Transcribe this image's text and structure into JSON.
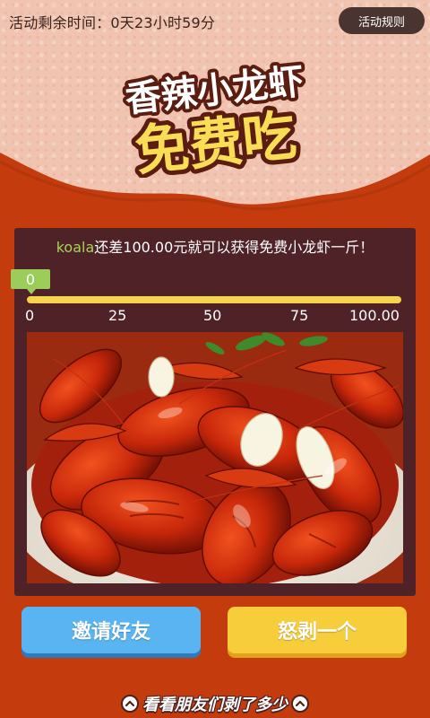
{
  "header": {
    "countdown": "活动剩余时间：0天23小时59分",
    "rules_button": "活动规则"
  },
  "title": {
    "line1": "香辣小龙虾",
    "line2": "免费吃"
  },
  "progress": {
    "user": "koala",
    "message": "还差100.00元就可以获得免费小龙虾一斤！",
    "current_label": "0",
    "fraction": 1.0,
    "ticks": [
      "0",
      "25",
      "50",
      "75",
      "100.00"
    ]
  },
  "photo": {
    "icon": "crayfish-photo"
  },
  "actions": {
    "invite": "邀请好友",
    "peel": "怒剥一个"
  },
  "footer": {
    "friends_link": "看看朋友们剥了多少"
  },
  "colors": {
    "background": "#c43c0e",
    "card": "#4e2227",
    "progress": "#f6d34c",
    "user_name": "#a6d25a",
    "invite_button": "#5ab4f2",
    "peel_button": "#f7cd3b"
  }
}
